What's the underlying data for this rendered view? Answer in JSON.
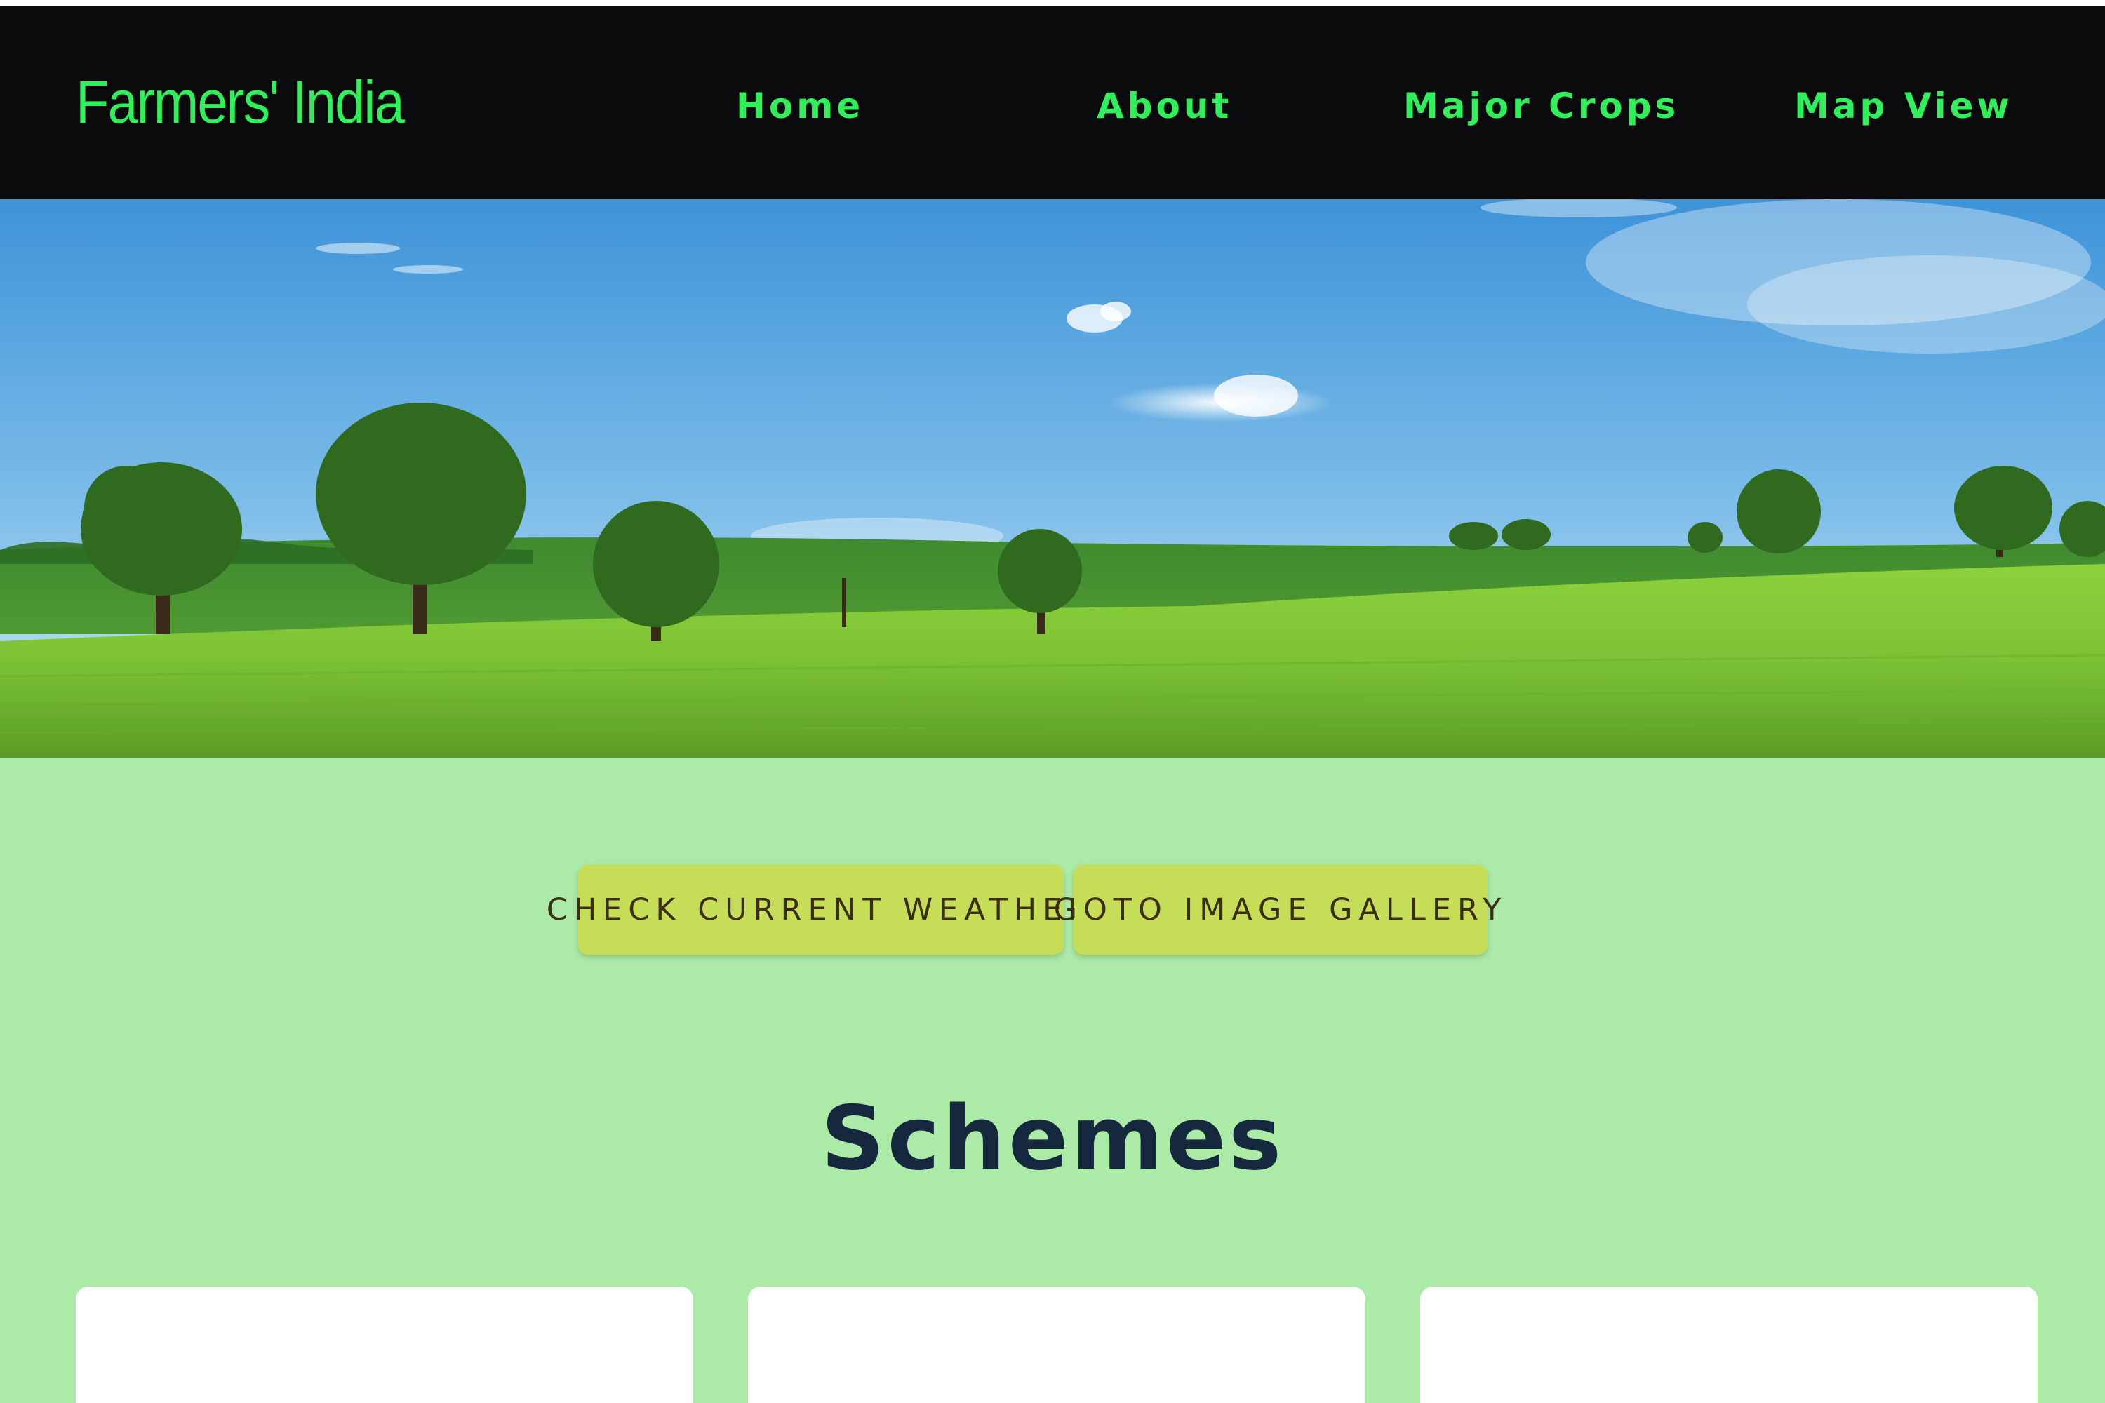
{
  "header": {
    "brand": "Farmers' India",
    "nav": [
      {
        "label": "Home"
      },
      {
        "label": "About"
      },
      {
        "label": "Major Crops"
      },
      {
        "label": "Map View"
      }
    ]
  },
  "hero": {
    "image": "green-field-with-trees-landscape"
  },
  "actions": {
    "weather_label": "CHECK CURRENT WEATHER",
    "gallery_label": "GOTO IMAGE GALLERY"
  },
  "schemes": {
    "title": "Schemes",
    "cards": [
      {},
      {},
      {}
    ]
  },
  "colors": {
    "nav_bg": "#0b0a0c",
    "nav_text": "#2ff05a",
    "page_bg": "#aceaa8",
    "button_bg": "#c6dd57",
    "button_text": "#3a2f12",
    "title_text": "#16283d",
    "card_bg": "#ffffff"
  }
}
